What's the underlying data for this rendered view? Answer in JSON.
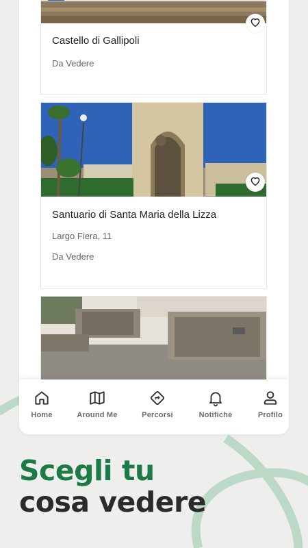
{
  "colors": {
    "accent_green": "#1c7a46",
    "dark_text": "#2b2b2b",
    "background": "#eeefec"
  },
  "cards": [
    {
      "title": "Castello di Gallipoli",
      "category": "Da Vedere",
      "favorite_icon": "heart-outline-icon"
    },
    {
      "title": "Santuario di Santa Maria della Lizza",
      "address": "Largo Fiera, 11",
      "category": "Da Vedere",
      "favorite_icon": "heart-outline-icon"
    },
    {
      "photo": "stone-ruins-photo"
    }
  ],
  "nav": {
    "items": [
      {
        "label": "Home",
        "icon": "home-icon"
      },
      {
        "label": "Around Me",
        "icon": "map-icon"
      },
      {
        "label": "Percorsi",
        "icon": "route-icon"
      },
      {
        "label": "Notifiche",
        "icon": "bell-icon"
      },
      {
        "label": "Profilo",
        "icon": "user-icon"
      }
    ]
  },
  "headline": {
    "line1": "Scegli tu",
    "line2": "cosa vedere"
  }
}
